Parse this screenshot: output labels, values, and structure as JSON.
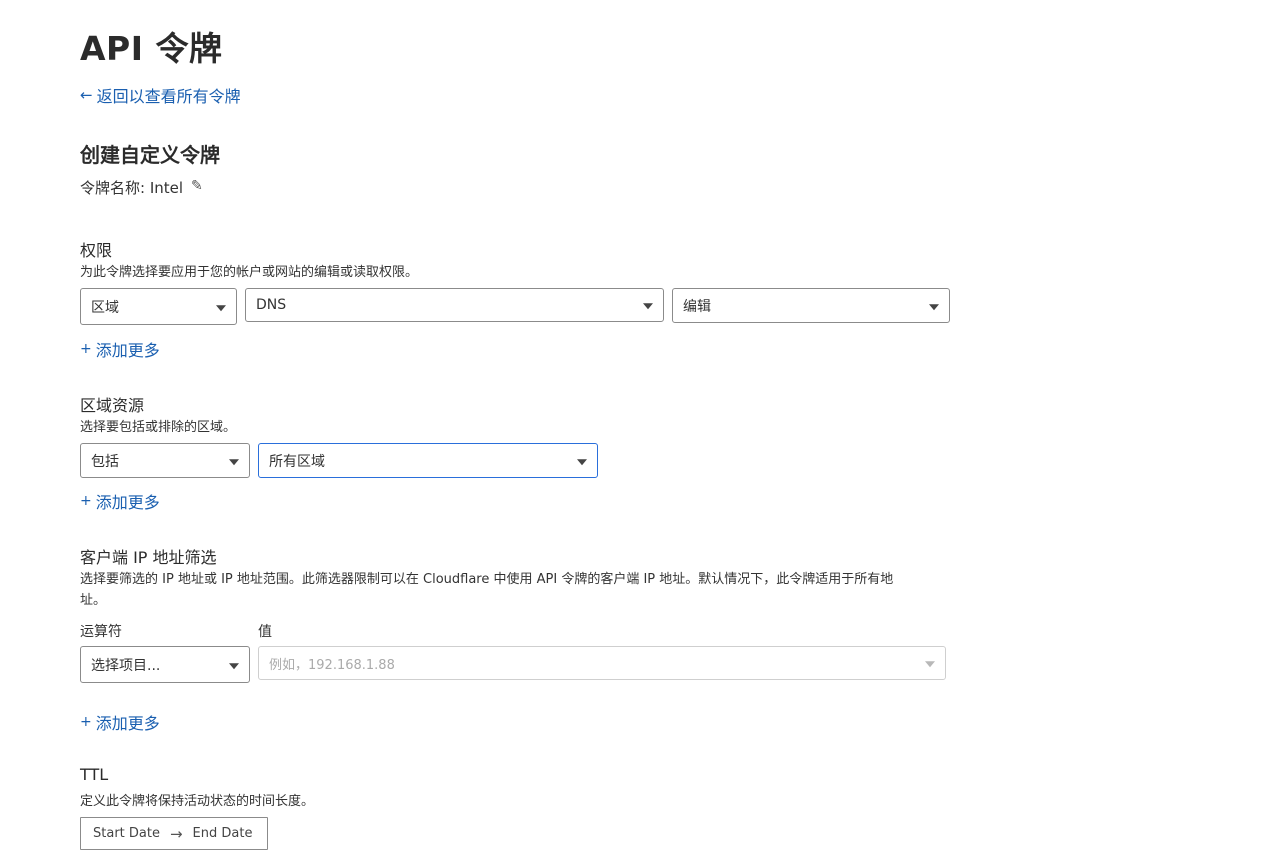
{
  "page": {
    "title": "API 令牌",
    "back_link": "返回以查看所有令牌",
    "section_title": "创建自定义令牌",
    "token_name_label": "令牌名称: Intel"
  },
  "permissions": {
    "title": "权限",
    "description": "为此令牌选择要应用于您的帐户或网站的编辑或读取权限。",
    "scope": "区域",
    "resource": "DNS",
    "access": "编辑",
    "add_more": "添加更多"
  },
  "zone_resources": {
    "title": "区域资源",
    "description": "选择要包括或排除的区域。",
    "mode": "包括",
    "zone": "所有区域",
    "add_more": "添加更多"
  },
  "ip_filter": {
    "title": "客户端 IP 地址筛选",
    "description_line1": "选择要筛选的 IP 地址或 IP 地址范围。此筛选器限制可以在 Cloudflare 中使用 API 令牌的客户端 IP 地址。默认情况下，此令牌适用于所有地",
    "description_line2": "址。",
    "operator_label": "运算符",
    "value_label": "值",
    "operator_placeholder": "选择项目...",
    "value_placeholder": "例如，192.168.1.88",
    "add_more": "添加更多"
  },
  "ttl": {
    "title": "TTL",
    "description": "定义此令牌将保持活动状态的时间长度。",
    "start_date": "Start Date",
    "end_date": "End Date"
  },
  "icons": {
    "back": "arrow-left-icon",
    "edit": "pencil-icon",
    "add": "plus-icon",
    "dropdown": "caret-down-icon",
    "range": "arrow-right-icon"
  },
  "colors": {
    "link": "#1a5fb0",
    "active_border": "#2a6fdb"
  }
}
